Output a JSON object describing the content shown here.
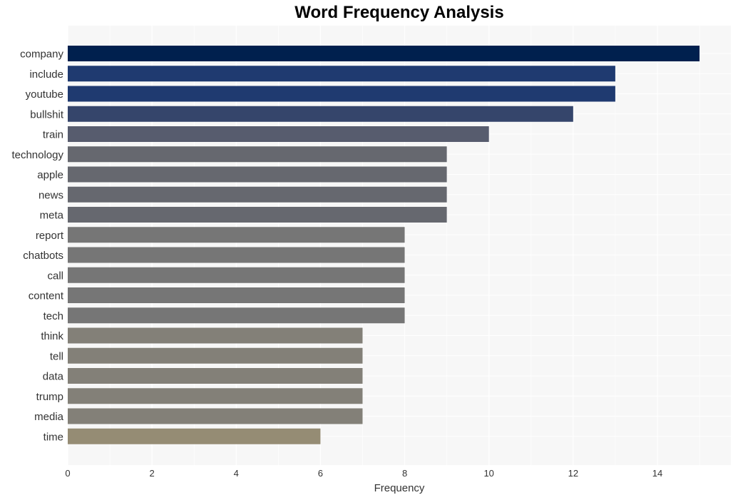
{
  "chart_data": {
    "type": "bar",
    "orientation": "horizontal",
    "title": "Word Frequency Analysis",
    "xlabel": "Frequency",
    "ylabel": "",
    "xlim": [
      0,
      15.75
    ],
    "xticks": [
      0,
      2,
      4,
      6,
      8,
      10,
      12,
      14
    ],
    "grid": true,
    "categories": [
      "company",
      "include",
      "youtube",
      "bullshit",
      "train",
      "technology",
      "apple",
      "news",
      "meta",
      "report",
      "chatbots",
      "call",
      "content",
      "tech",
      "think",
      "tell",
      "data",
      "trump",
      "media",
      "time"
    ],
    "values": [
      15,
      13,
      13,
      12,
      10,
      9,
      9,
      9,
      9,
      8,
      8,
      8,
      8,
      8,
      7,
      7,
      7,
      7,
      7,
      6
    ],
    "colors": [
      "#00204e",
      "#1f3a70",
      "#1f3a70",
      "#35456b",
      "#575c6e",
      "#66686f",
      "#66686f",
      "#66686f",
      "#66686f",
      "#767676",
      "#767676",
      "#767676",
      "#767676",
      "#767676",
      "#838078",
      "#838078",
      "#838078",
      "#838078",
      "#838078",
      "#958c74"
    ]
  }
}
